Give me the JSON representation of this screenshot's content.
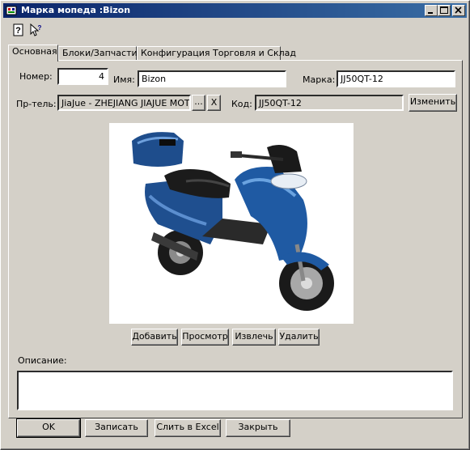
{
  "window": {
    "title": "Марка мопеда :Bizon"
  },
  "toolbar": {
    "icons": [
      "help-icon",
      "context-help-icon"
    ]
  },
  "tabs": [
    "Основная",
    "Блоки/Запчасти",
    "Конфигурация Торговля и Склад"
  ],
  "form": {
    "number_label": "Номер:",
    "number_value": "4",
    "name_label": "Имя:",
    "name_value": "Bizon",
    "brand_label": "Марка:",
    "brand_value": "JJ50QT-12",
    "manufacturer_label": "Пр-тель:",
    "manufacturer_value": "JiaJue - ZHEJIANG JIAJUE MOT",
    "browse_label": "...",
    "clear_label": "X",
    "code_label": "Код:",
    "code_value": "JJ50QT-12",
    "change_label": "Изменить",
    "description_label": "Описание:",
    "description_value": ""
  },
  "image_buttons": {
    "add": "Добавить",
    "view": "Просмотр",
    "extract": "Извлечь",
    "delete": "Удалить"
  },
  "footer": {
    "ok": "OK",
    "save": "Записать",
    "excel": "Слить в Excel",
    "close": "Закрыть"
  }
}
